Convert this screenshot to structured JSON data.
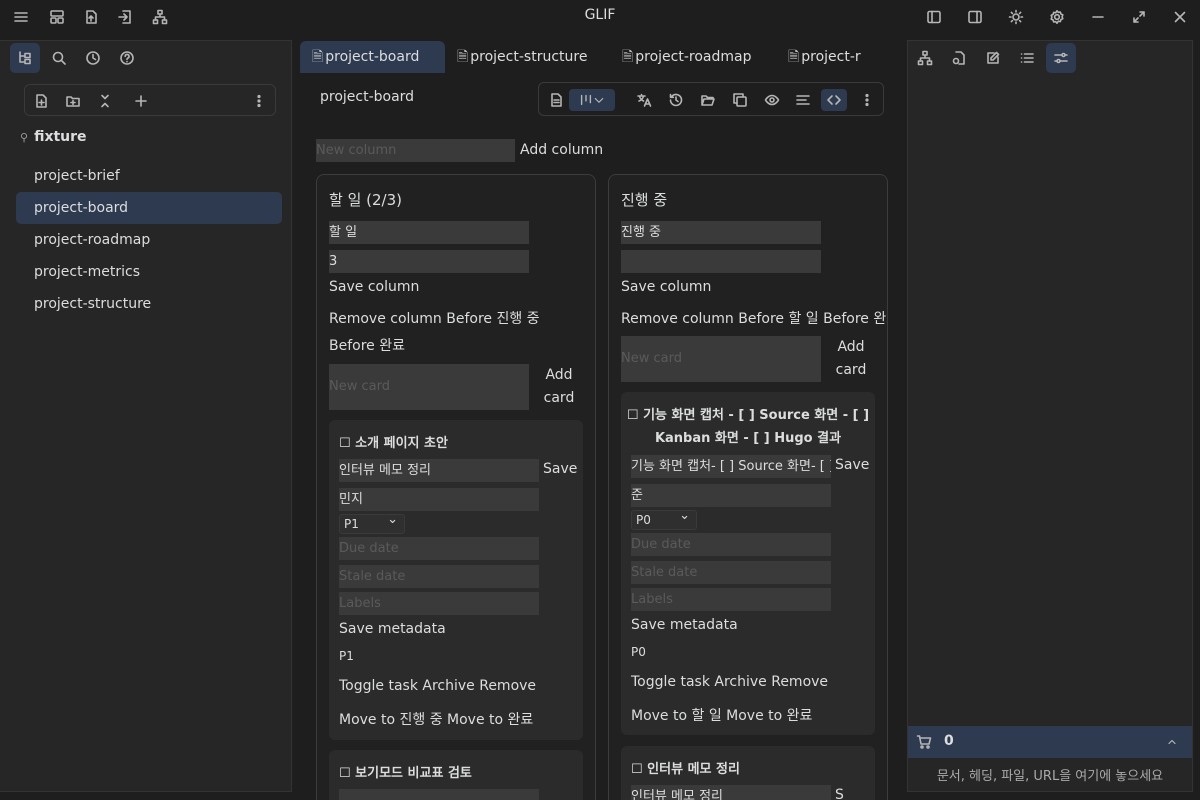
{
  "app": {
    "title": "GLIF"
  },
  "left_panel": {
    "vault_name": "fixture",
    "files": [
      "project-brief",
      "project-board",
      "project-roadmap",
      "project-metrics",
      "project-structure"
    ]
  },
  "tabs": [
    {
      "label": "project-board"
    },
    {
      "label": "project-structure"
    },
    {
      "label": "project-roadmap"
    },
    {
      "label": "project-r"
    }
  ],
  "note": {
    "title": "project-board"
  },
  "board": {
    "new_column_placeholder": "New column",
    "add_column_label": "Add column",
    "columns": [
      {
        "title": "할 일 (2/3)",
        "name_value": "할 일",
        "limit_value": "3",
        "save_column": "Save column",
        "remove_line": "Remove column Before 진행 중",
        "before_line": "Before 완료",
        "new_card_placeholder": "New card",
        "add_card": "Add card",
        "cards": [
          {
            "title": "☐ 소개 페이지 초안",
            "title_input": "인터뷰 메모 정리",
            "save": "Save",
            "assignee": "민지",
            "priority": "P1",
            "due_placeholder": "Due date",
            "stale_placeholder": "Stale date",
            "labels_placeholder": "Labels",
            "save_metadata": "Save metadata",
            "priority_badge": "P1",
            "actions": "Toggle task Archive Remove",
            "moves": "Move to 진행 중 Move to 완료"
          },
          {
            "title": "☐ 보기모드 비교표 검토"
          }
        ]
      },
      {
        "title": "진행 중",
        "name_value": "진행 중",
        "limit_value": "",
        "save_column": "Save column",
        "remove_line": "Remove column Before 할 일 Before 완료",
        "new_card_placeholder": "New card",
        "add_card": "Add card",
        "cards": [
          {
            "title_line1": "☐ 기능 화면 캡처 - [ ] Source 화면 - [ ]",
            "title_line2": "Kanban 화면 - [ ] Hugo 결과",
            "title_input": "기능 화면 캡처- [ ] Source 화면- [ ]",
            "save": "Save",
            "assignee": "준",
            "priority": "P0",
            "due_placeholder": "Due date",
            "stale_placeholder": "Stale date",
            "labels_placeholder": "Labels",
            "save_metadata": "Save metadata",
            "priority_badge": "P0",
            "actions": "Toggle task Archive Remove",
            "moves": "Move to 할 일 Move to 완료"
          },
          {
            "title": "☐ 인터뷰 메모 정리",
            "title_input": "인터뷰 메모 정리",
            "save": "S"
          }
        ]
      }
    ]
  },
  "right_panel": {
    "cart_count": "0",
    "drop_hint": "문서, 헤딩, 파일, URL을 여기에 놓으세요"
  }
}
